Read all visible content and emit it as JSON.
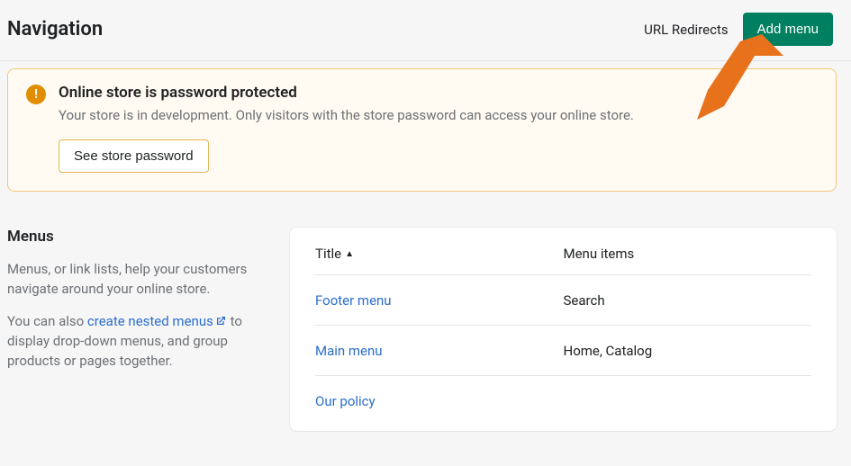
{
  "header": {
    "title": "Navigation",
    "url_redirects": "URL Redirects",
    "add_menu": "Add menu"
  },
  "banner": {
    "icon_glyph": "!",
    "heading": "Online store is password protected",
    "body": "Your store is in development. Only visitors with the store password can access your online store.",
    "button": "See store password"
  },
  "sidebar": {
    "heading": "Menus",
    "p1": "Menus, or link lists, help your customers navigate around your online store.",
    "p2_before": "You can also ",
    "p2_link": "create nested menus",
    "p2_after": " to display drop-down menus, and group products or pages together."
  },
  "table": {
    "col_title": "Title",
    "col_items": "Menu items",
    "rows": [
      {
        "title": "Footer menu",
        "items": "Search"
      },
      {
        "title": "Main menu",
        "items": "Home, Catalog"
      },
      {
        "title": "Our policy",
        "items": ""
      }
    ]
  }
}
